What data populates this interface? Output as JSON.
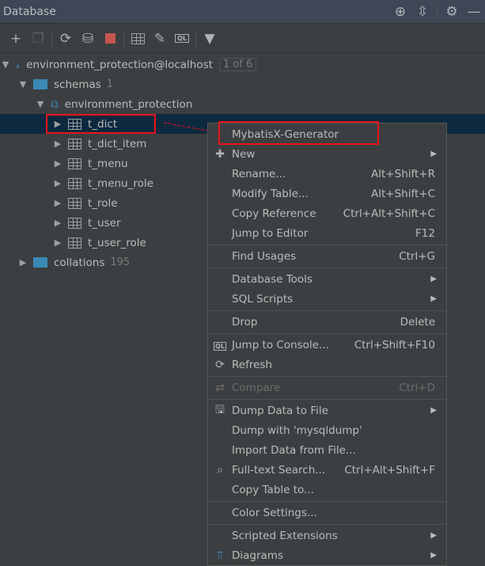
{
  "header": {
    "title": "Database",
    "icons": [
      "crosshair-icon",
      "collapse-icon",
      "gear-icon",
      "minimize-icon"
    ]
  },
  "toolbar": {
    "icons": [
      "add-icon",
      "duplicate-icon",
      "refresh-icon",
      "schema-tools-icon",
      "stop-icon",
      "table-icon",
      "edit-icon",
      "console-icon",
      "filter-icon"
    ],
    "stop_color": "#c75450"
  },
  "tree": {
    "connection": {
      "label": "environment_protection@localhost",
      "badge": "1 of 6"
    },
    "schemas": {
      "label": "schemas",
      "count": "1"
    },
    "schema": {
      "label": "environment_protection"
    },
    "tables": [
      "t_dict",
      "t_dict_item",
      "t_menu",
      "t_menu_role",
      "t_role",
      "t_user",
      "t_user_role"
    ],
    "collations": {
      "label": "collations",
      "count": "195"
    }
  },
  "menu": {
    "items": [
      {
        "label": "MybatisX-Generator",
        "shortcut": "",
        "icon": "",
        "submenu": false
      },
      {
        "label": "New",
        "shortcut": "",
        "icon": "plus-icon",
        "submenu": true
      },
      {
        "label": "Rename...",
        "shortcut": "Alt+Shift+R",
        "submenu": false
      },
      {
        "label": "Modify Table...",
        "shortcut": "Alt+Shift+C",
        "submenu": false
      },
      {
        "label": "Copy Reference",
        "shortcut": "Ctrl+Alt+Shift+C",
        "submenu": false
      },
      {
        "label": "Jump to Editor",
        "shortcut": "F12",
        "submenu": false
      },
      {
        "label": "Find Usages",
        "shortcut": "Ctrl+G",
        "submenu": false
      },
      {
        "label": "Database Tools",
        "shortcut": "",
        "submenu": true
      },
      {
        "label": "SQL Scripts",
        "shortcut": "",
        "submenu": true
      },
      {
        "label": "Drop",
        "shortcut": "Delete",
        "submenu": false
      },
      {
        "label": "Jump to Console...",
        "shortcut": "Ctrl+Shift+F10",
        "icon": "console-icon",
        "submenu": false
      },
      {
        "label": "Refresh",
        "shortcut": "",
        "icon": "refresh-icon",
        "submenu": false
      },
      {
        "label": "Compare",
        "shortcut": "Ctrl+D",
        "icon": "compare-icon",
        "submenu": false,
        "disabled": true
      },
      {
        "label": "Dump Data to File",
        "shortcut": "",
        "icon": "save-icon",
        "submenu": true
      },
      {
        "label": "Dump with 'mysqldump'",
        "shortcut": "",
        "submenu": false
      },
      {
        "label": "Import Data from File...",
        "shortcut": "",
        "submenu": false
      },
      {
        "label": "Full-text Search...",
        "shortcut": "Ctrl+Alt+Shift+F",
        "icon": "search-icon",
        "submenu": false
      },
      {
        "label": "Copy Table to...",
        "shortcut": "",
        "submenu": false
      },
      {
        "label": "Color Settings...",
        "shortcut": "",
        "submenu": false
      },
      {
        "label": "Scripted Extensions",
        "shortcut": "",
        "submenu": true
      },
      {
        "label": "Diagrams",
        "shortcut": "",
        "icon": "diagram-icon",
        "submenu": true
      }
    ]
  },
  "annotation_color": "#e8141b"
}
